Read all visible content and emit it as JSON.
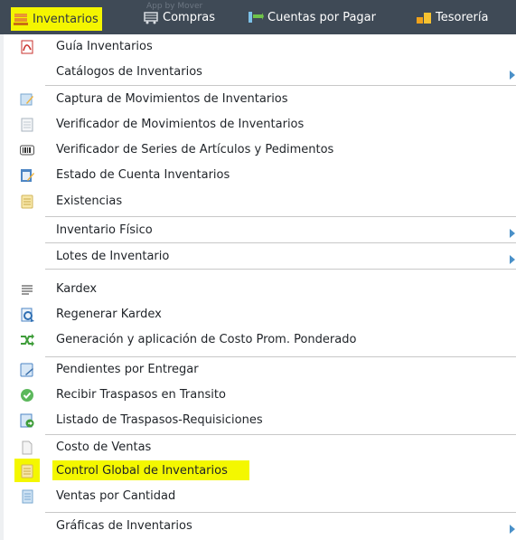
{
  "menubar": {
    "faint_tag": "App by Mover",
    "items": [
      {
        "label": "Inventarios",
        "icon": "warehouse-icon"
      },
      {
        "label": "Compras",
        "icon": "cart-icon"
      },
      {
        "label": "Cuentas por Pagar",
        "icon": "accounts-payable-icon"
      },
      {
        "label": "Tesorería",
        "icon": "moneybag-icon"
      }
    ]
  },
  "dropdown": {
    "items": [
      {
        "label": "Guía Inventarios",
        "icon": "pdf-icon"
      },
      {
        "label": "Catálogos de Inventarios",
        "icon": "",
        "submenu": true
      },
      {
        "label": "Captura de Movimientos de Inventarios",
        "icon": "edit-form-icon"
      },
      {
        "label": "Verificador de Movimientos de Inventarios",
        "icon": "document-icon"
      },
      {
        "label": "Verificador de Series de Artículos y Pedimentos",
        "icon": "barcode-icon"
      },
      {
        "label": "Estado de Cuenta Inventarios",
        "icon": "notepad-edit-icon"
      },
      {
        "label": "Existencias",
        "icon": "notepad-icon"
      },
      {
        "label": "Inventario Físico",
        "icon": "",
        "submenu": true
      },
      {
        "label": "Lotes de Inventario",
        "icon": "",
        "submenu": true
      },
      {
        "label": "Kardex",
        "icon": "lines-icon"
      },
      {
        "label": "Regenerar Kardex",
        "icon": "refresh-document-icon"
      },
      {
        "label": "Generación y aplicación de Costo Prom. Ponderado",
        "icon": "shuffle-icon"
      },
      {
        "label": "Pendientes por Entregar",
        "icon": "pending-delivery-icon"
      },
      {
        "label": "Recibir Traspasos en Transito",
        "icon": "check-circle-icon"
      },
      {
        "label": "Listado de Traspasos-Requisiciones",
        "icon": "transfer-list-icon"
      },
      {
        "label": "Costo de Ventas",
        "icon": "blank-document-icon"
      },
      {
        "label": "Control Global de Inventarios",
        "icon": "notepad-icon"
      },
      {
        "label": "Ventas por Cantidad",
        "icon": "table-document-icon"
      },
      {
        "label": "Gráficas de Inventarios",
        "icon": "",
        "submenu": true
      }
    ]
  }
}
